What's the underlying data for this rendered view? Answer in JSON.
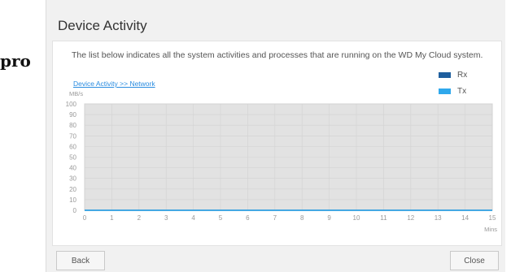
{
  "background_text": "pro",
  "dialog": {
    "title": "Device Activity",
    "description": "The list below indicates all the system activities and processes that are running on the WD My Cloud system.",
    "link": "Device Activity >> Network",
    "buttons": {
      "back": "Back",
      "close": "Close"
    }
  },
  "colors": {
    "rx": "#1f5f9e",
    "tx": "#2fa8ec",
    "plot_bg": "#e2e2e2",
    "grid": "#d3d3d3"
  },
  "chart_data": {
    "type": "line",
    "ylabel": "MB/s",
    "xlabel": "Mins",
    "xlim": [
      0,
      15
    ],
    "ylim": [
      0,
      100
    ],
    "xticks": [
      0,
      1,
      2,
      3,
      4,
      5,
      6,
      7,
      8,
      9,
      10,
      11,
      12,
      13,
      14,
      15
    ],
    "yticks": [
      0,
      10,
      20,
      30,
      40,
      50,
      60,
      70,
      80,
      90,
      100
    ],
    "legend_position": "top-right",
    "series": [
      {
        "name": "Rx",
        "color": "#1f5f9e",
        "x": [
          0,
          15
        ],
        "y": [
          0,
          0
        ]
      },
      {
        "name": "Tx",
        "color": "#2fa8ec",
        "x": [
          0,
          15
        ],
        "y": [
          0,
          0
        ]
      }
    ]
  }
}
